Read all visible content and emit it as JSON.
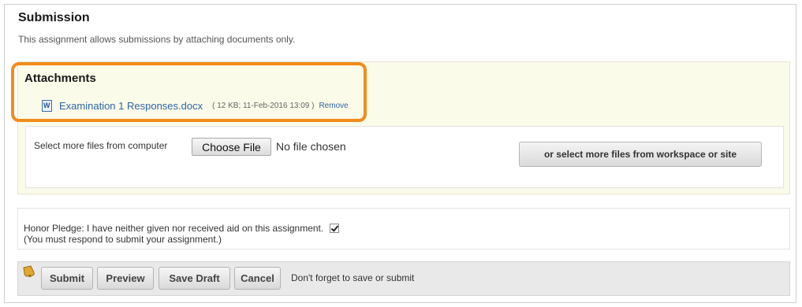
{
  "submission": {
    "title": "Submission",
    "description": "This assignment allows submissions by attaching documents only."
  },
  "attachments": {
    "title": "Attachments",
    "file": {
      "name": "Examination 1 Responses.docx",
      "meta": "( 12 KB; 11-Feb-2016 13:09 )",
      "remove_label": "Remove",
      "icon": "word-document-icon"
    },
    "highlight_color": "#f28c1c"
  },
  "upload": {
    "label": "Select more files from computer",
    "choose_label": "Choose File",
    "status": "No file chosen",
    "site_button_label": "or select more files from workspace or site"
  },
  "pledge": {
    "text": "Honor Pledge: I have neither given nor received aid on this assignment.",
    "note": "(You must respond to submit your assignment.)",
    "checked": true
  },
  "actions": {
    "icon": "bell-icon",
    "submit_label": "Submit",
    "preview_label": "Preview",
    "save_draft_label": "Save Draft",
    "cancel_label": "Cancel",
    "reminder": "Don't forget to save or submit"
  }
}
